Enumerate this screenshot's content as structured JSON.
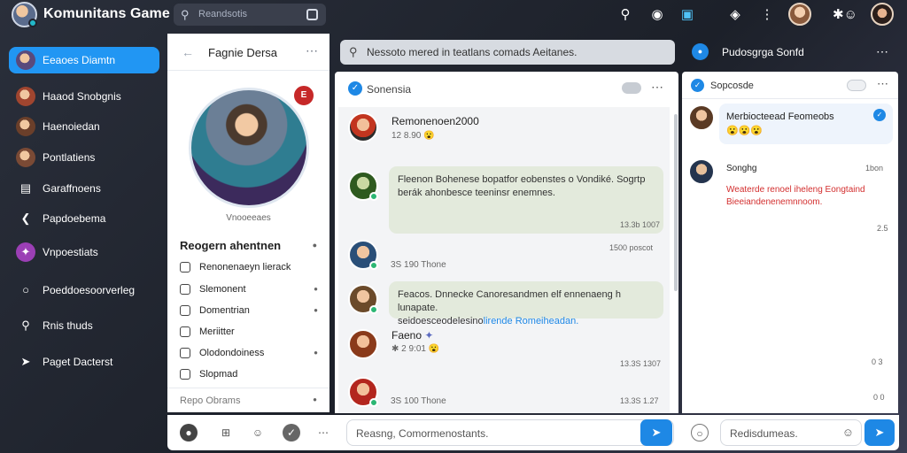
{
  "app": {
    "title": "Komunitans Game"
  },
  "topbar": {
    "search_placeholder": "Reandsotis"
  },
  "sidebar": {
    "items": [
      {
        "label": "Eeaoes Diamtn"
      },
      {
        "label": "Haaod Snobgnis"
      },
      {
        "label": "Haenoiedan"
      },
      {
        "label": "Pontlatiens"
      },
      {
        "label": "Garaffnoens"
      },
      {
        "label": "Papdoebema"
      },
      {
        "label": "Vnpoestiats"
      },
      {
        "label": "Poeddoesoorverleg"
      },
      {
        "label": "Rnis thuds"
      },
      {
        "label": "Paget Dacterst"
      }
    ]
  },
  "profile": {
    "title": "Fagnie Dersa",
    "badge": "E",
    "caption": "Vnooeeaes",
    "section_title": "Reogern ahentnen",
    "rows": [
      {
        "label": "Renonenaeyn lierack"
      },
      {
        "label": "Slemonent"
      },
      {
        "label": "Domentrian"
      },
      {
        "label": "Meriitter"
      },
      {
        "label": "Olodondoiness"
      },
      {
        "label": "Slopmad"
      }
    ],
    "footer": "Repo Obrams"
  },
  "main": {
    "search_text": "Nessoto mered in teatlans comads Aeitanes.",
    "chat_name": "Sonensia",
    "messages": [
      {
        "name": "Remonenoen2000",
        "meta": "12 8.90"
      },
      {
        "text_line1": "Fleenon Bohenese bopatfor eobenstes o Vondiké. Sogrtp",
        "text_line2": "berák ahonbesce teeninsr enemnes.",
        "time": "13.3b 1007",
        "footer": "1500 poscot"
      },
      {
        "meta": "3S 190 Thone"
      },
      {
        "text_line1": "Feacos. Dnnecke Canoresandmen elf ennenaeng h lunapate.",
        "text_pre": "seidoesceodelesino",
        "text_link": "lirende Romeiheadan.",
        "time": ""
      },
      {
        "name": "Faeno",
        "meta": "2 9:01"
      },
      {
        "meta": "3S 100 Thone",
        "time": "13.3S 1307"
      },
      {
        "time": "13.3S 1.27"
      }
    ]
  },
  "right": {
    "header_title": "Pudosgrga Sonfd",
    "panel_title": "Sopcosde",
    "card1_title": "Merbiocteead Feomeobs",
    "card2_name": "Songhg",
    "card2_time": "1bon",
    "card2_line1": "Weaterde renoel iheleng Eongtaind",
    "card2_line2": "Bieeiandenenemnnoom.",
    "count1": "2.5",
    "count2": "0 3",
    "count3": "0 0"
  },
  "composer": {
    "main_placeholder": "Reasng, Comormenostants.",
    "right_placeholder": "Redisdumeas."
  },
  "colors": {
    "accent": "#2196f3",
    "send": "#1e88e5",
    "online": "#2bb673",
    "bubble": "#e3eadc"
  }
}
